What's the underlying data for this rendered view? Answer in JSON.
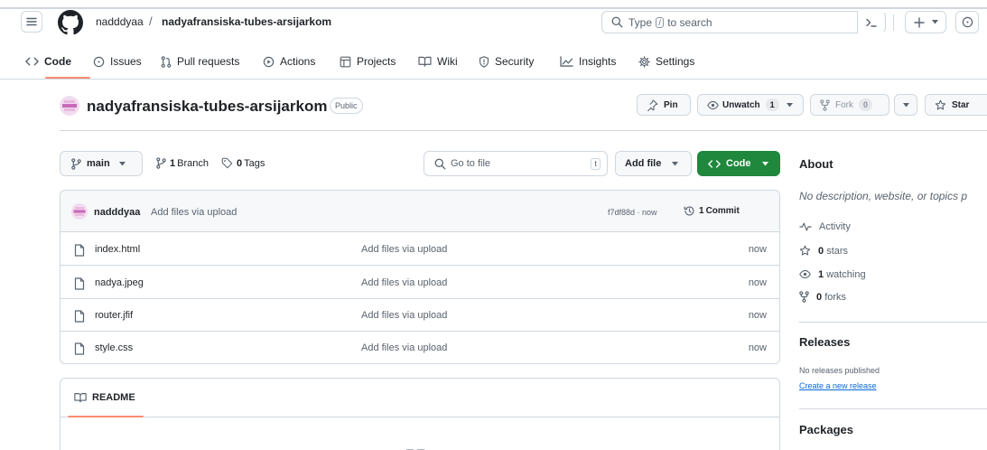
{
  "header": {
    "owner": "nadddyaa",
    "separator": "/",
    "repo": "nadyafransiska-tubes-arsijarkom",
    "search_prefix": "Type",
    "search_key": "/",
    "search_suffix": "to search"
  },
  "tabs": [
    {
      "label": "Code",
      "icon": "code-icon",
      "active": true
    },
    {
      "label": "Issues",
      "icon": "issue-icon"
    },
    {
      "label": "Pull requests",
      "icon": "pull-request-icon"
    },
    {
      "label": "Actions",
      "icon": "play-icon"
    },
    {
      "label": "Projects",
      "icon": "table-icon"
    },
    {
      "label": "Wiki",
      "icon": "book-icon"
    },
    {
      "label": "Security",
      "icon": "shield-icon"
    },
    {
      "label": "Insights",
      "icon": "graph-icon"
    },
    {
      "label": "Settings",
      "icon": "gear-icon"
    }
  ],
  "repo": {
    "title": "nadyafransiska-tubes-arsijarkom",
    "visibility": "Public",
    "pin_label": "Pin",
    "unwatch_label": "Unwatch",
    "watch_count": "1",
    "fork_label": "Fork",
    "fork_count": "0",
    "star_label": "Star"
  },
  "controls": {
    "branch": "main",
    "branches_count": "1",
    "branches_label": "Branch",
    "tags_count": "0",
    "tags_label": "Tags",
    "goto_placeholder": "Go to file",
    "goto_key": "t",
    "add_file": "Add file",
    "code": "Code"
  },
  "commit": {
    "author": "nadddyaa",
    "message": "Add files via upload",
    "hash_time": "f7df88d · now",
    "commits_count": "1",
    "commits_label": "Commit"
  },
  "files": [
    {
      "name": "index.html",
      "message": "Add files via upload",
      "time": "now"
    },
    {
      "name": "nadya.jpeg",
      "message": "Add files via upload",
      "time": "now"
    },
    {
      "name": "router.jfif",
      "message": "Add files via upload",
      "time": "now"
    },
    {
      "name": "style.css",
      "message": "Add files via upload",
      "time": "now"
    }
  ],
  "readme": {
    "label": "README"
  },
  "sidebar": {
    "about_title": "About",
    "about_desc": "No description, website, or topics p",
    "activity": "Activity",
    "stars_count": "0",
    "stars_label": "stars",
    "watching_count": "1",
    "watching_label": "watching",
    "forks_count": "0",
    "forks_label": "forks",
    "releases_title": "Releases",
    "no_releases": "No releases published",
    "create_release": "Create a new release",
    "packages_title": "Packages"
  },
  "colors": {
    "accent_green": "#1f883d",
    "tab_underline": "#fd8c73",
    "link": "#0969da",
    "border": "#d0d7de",
    "muted": "#59636e"
  }
}
